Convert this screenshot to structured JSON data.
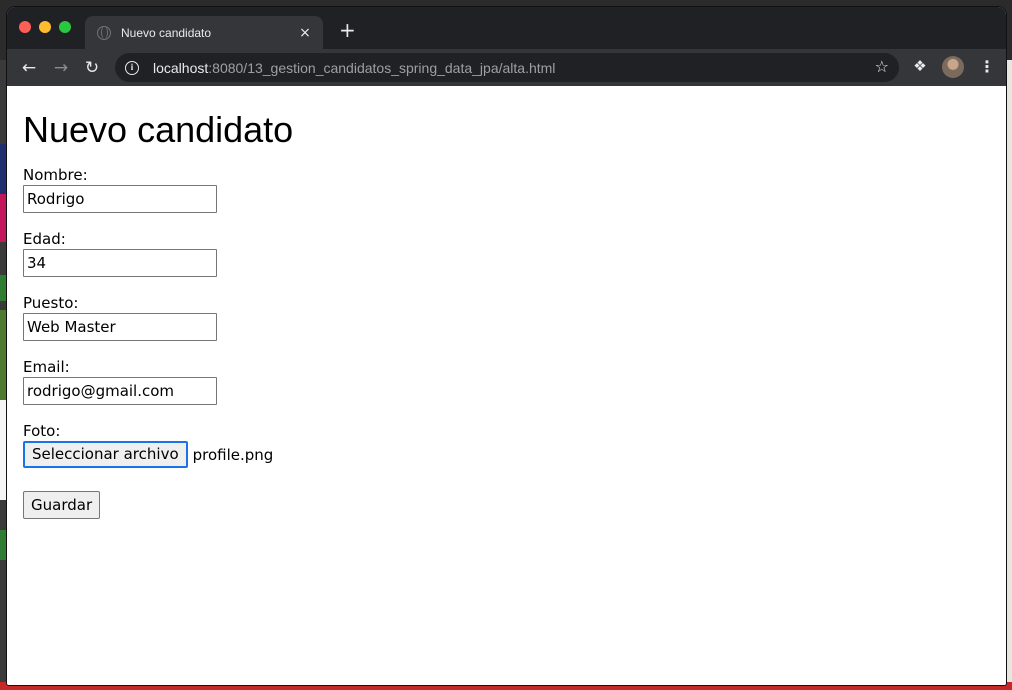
{
  "browser": {
    "tab_title": "Nuevo candidato",
    "tab_close": "×",
    "new_tab": "+",
    "url_host": "localhost",
    "url_rest": ":8080/13_gestion_candidatos_spring_data_jpa/alta.html",
    "icons": {
      "back": "arrow-left-icon",
      "forward": "arrow-right-icon",
      "reload": "reload-icon",
      "info": "info-icon",
      "bookmark": "star-icon",
      "extensions": "puzzle-icon",
      "menu": "kebab-menu-icon"
    }
  },
  "page": {
    "title": "Nuevo candidato",
    "fields": [
      {
        "label": "Nombre:",
        "value": "Rodrigo"
      },
      {
        "label": "Edad:",
        "value": "34"
      },
      {
        "label": "Puesto:",
        "value": "Web Master"
      },
      {
        "label": "Email:",
        "value": "rodrigo@gmail.com"
      }
    ],
    "foto": {
      "label": "Foto:",
      "button_label": "Seleccionar archivo",
      "file_name": "profile.png"
    },
    "submit_label": "Guardar"
  },
  "colors": {
    "tabbar_bg": "#202124",
    "toolbar_bg": "#35363a",
    "focus_ring": "#1a73e8"
  }
}
